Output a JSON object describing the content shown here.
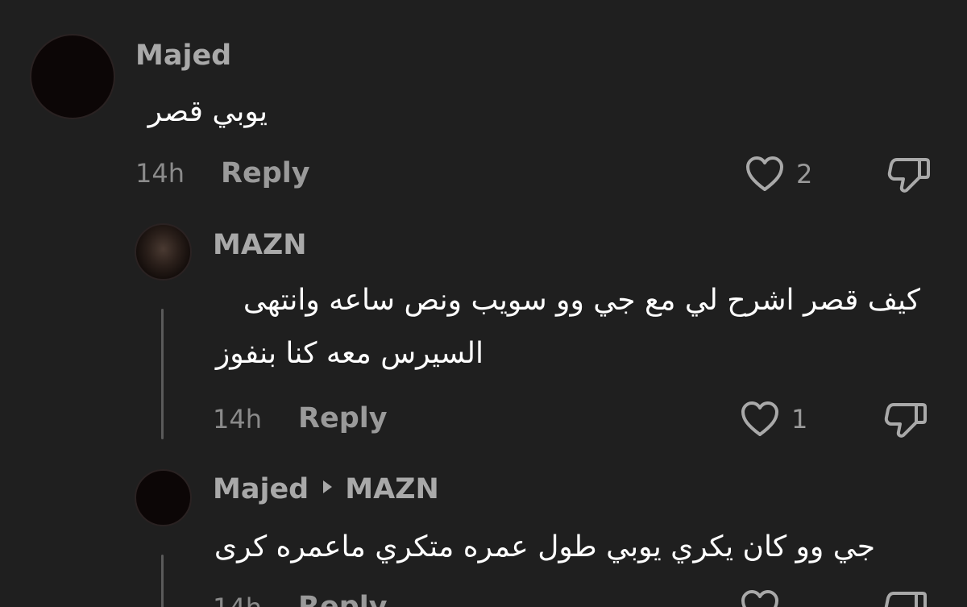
{
  "comments": [
    {
      "username": "Majed",
      "text": "يوبي قصر",
      "time": "14h",
      "reply_label": "Reply",
      "likes": "2"
    },
    {
      "username": "MAZN",
      "text_line1": "كيف قصر اشرح لي مع جي وو سويب ونص ساعه وانتهى",
      "text_line2": "السيرس معه كنا بنفوز",
      "time": "14h",
      "reply_label": "Reply",
      "likes": "1"
    },
    {
      "username": "Majed",
      "reply_to": "MAZN",
      "text": "جي وو كان يكري يوبي طول عمره متكري ماعمره كرى",
      "time": "14h",
      "reply_label": "Reply"
    }
  ],
  "colors": {
    "background": "#1f1f1f",
    "text": "#ffffff",
    "muted": "#9a9a9a"
  },
  "icons": [
    "heart-icon",
    "thumbs-down-icon",
    "reply-arrow-icon"
  ]
}
